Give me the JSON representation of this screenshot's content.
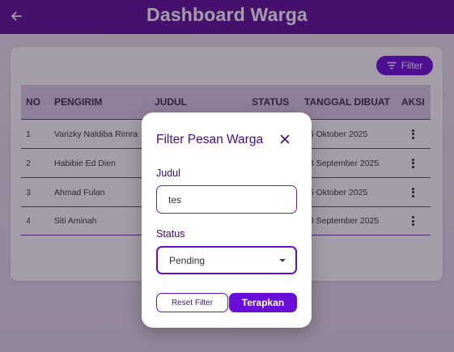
{
  "appbar": {
    "title": "Dashboard Warga"
  },
  "toolbar": {
    "filter_label": "Filter"
  },
  "table": {
    "headers": {
      "no": "NO",
      "pengirim": "PENGIRIM",
      "judul": "JUDUL",
      "status": "STATUS",
      "tanggal": "TANGGAL DIBUAT",
      "aksi": "AKSI"
    },
    "rows": [
      {
        "no": "1",
        "pengirim": "Varizky Naldiba Rimra",
        "tanggal": "15 Oktober 2025"
      },
      {
        "no": "2",
        "pengirim": "Habibie Ed Dien",
        "tanggal": "28 September 2025"
      },
      {
        "no": "3",
        "pengirim": "Ahmad Fulan",
        "tanggal": "15 Oktober 2025"
      },
      {
        "no": "4",
        "pengirim": "Siti Aminah",
        "tanggal": "30 September 2025"
      }
    ]
  },
  "dialog": {
    "title": "Filter Pesan Warga",
    "judul_label": "Judul",
    "judul_value": "tes",
    "status_label": "Status",
    "status_value": "Pending",
    "reset_label": "Reset Filter",
    "apply_label": "Terapkan"
  },
  "colors": {
    "primary": "#6a0dd8",
    "appbar": "#5b1197",
    "header_bg": "#d9cde3"
  },
  "icons": {
    "back": "arrow-left-icon",
    "filter": "filter-icon",
    "close": "close-icon",
    "more": "more-vert-icon",
    "dropdown": "caret-down-icon"
  }
}
